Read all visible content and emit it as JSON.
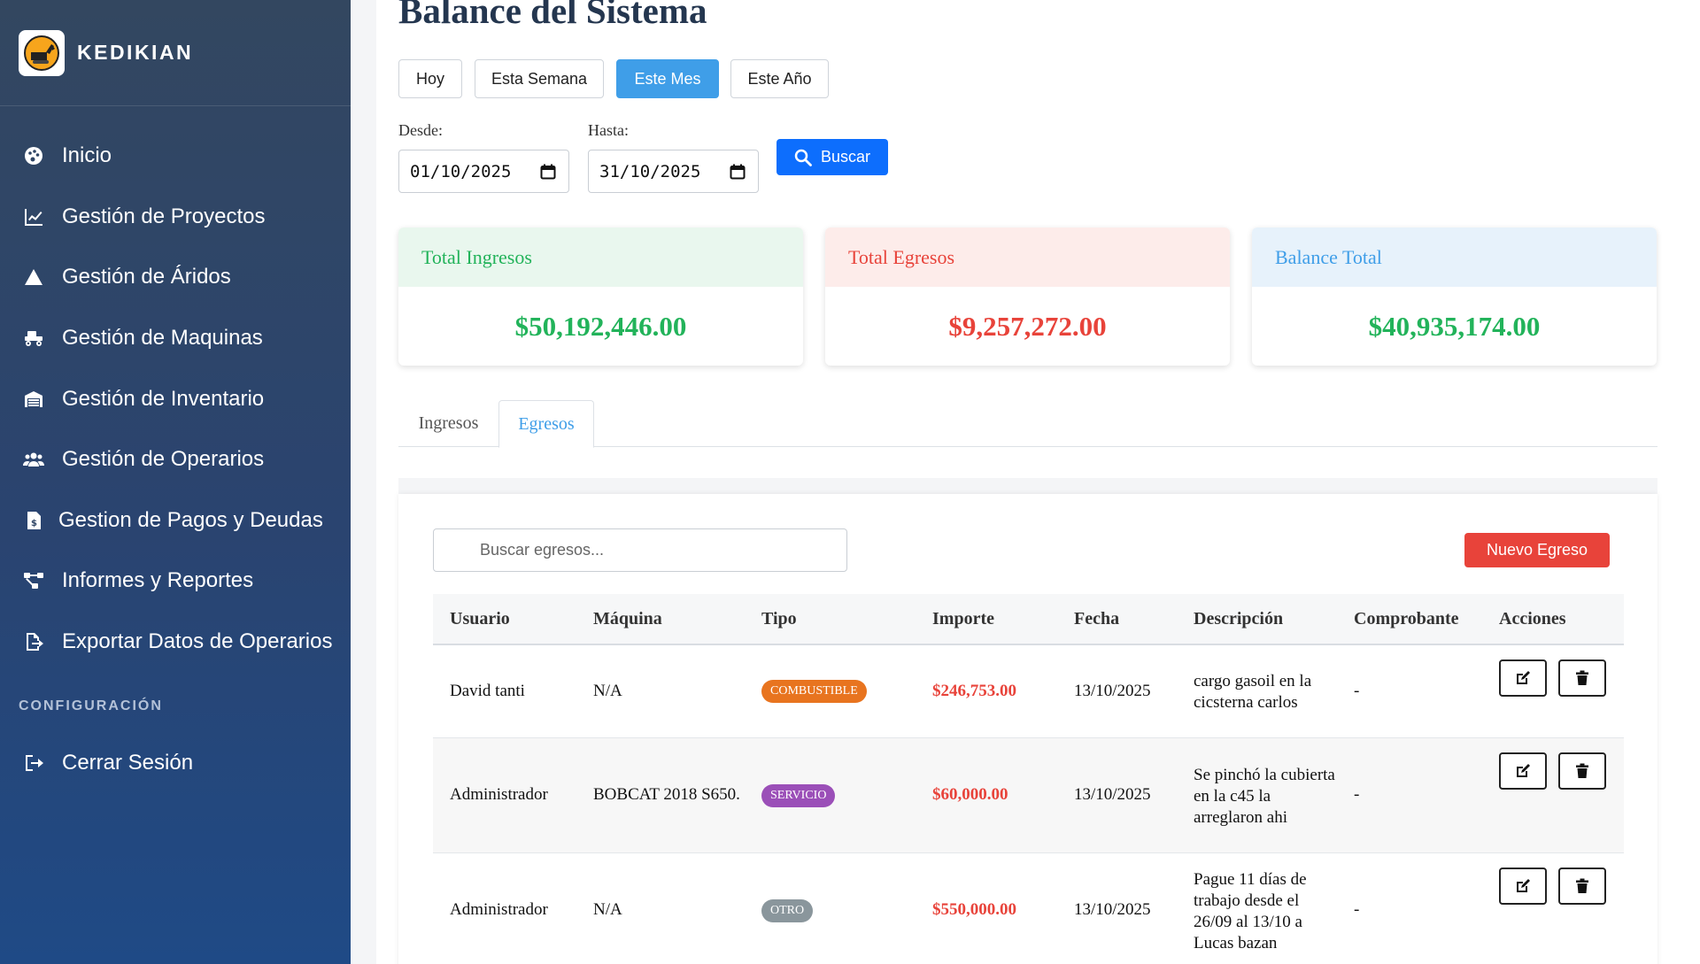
{
  "brand": {
    "name": "KEDIKIAN"
  },
  "sidebar": {
    "items": [
      {
        "label": "Inicio",
        "icon": "palette-icon"
      },
      {
        "label": "Gestión de Proyectos",
        "icon": "chart-line-icon"
      },
      {
        "label": "Gestión de Áridos",
        "icon": "mountain-icon"
      },
      {
        "label": "Gestión de Maquinas",
        "icon": "truck-icon"
      },
      {
        "label": "Gestión de Inventario",
        "icon": "warehouse-icon"
      },
      {
        "label": "Gestión de Operarios",
        "icon": "users-icon"
      },
      {
        "label": "Gestion de Pagos y Deudas",
        "icon": "invoice-dollar-icon"
      },
      {
        "label": "Informes y Reportes",
        "icon": "project-diagram-icon"
      },
      {
        "label": "Exportar Datos de Operarios",
        "icon": "file-export-icon"
      }
    ],
    "section_title": "CONFIGURACIÓN",
    "logout_label": "Cerrar Sesión"
  },
  "page": {
    "title": "Balance del Sistema"
  },
  "periods": {
    "hoy": "Hoy",
    "semana": "Esta Semana",
    "mes": "Este Mes",
    "anio": "Este Año",
    "active": "Este Mes"
  },
  "filters": {
    "desde_label": "Desde:",
    "desde_value": "01/10/2025",
    "hasta_label": "Hasta:",
    "hasta_value": "31/10/2025",
    "search_label": "Buscar"
  },
  "cards": {
    "ingresos": {
      "title": "Total Ingresos",
      "value": "$50,192,446.00"
    },
    "egresos": {
      "title": "Total Egresos",
      "value": "$9,257,272.00"
    },
    "balance": {
      "title": "Balance Total",
      "value": "$40,935,174.00"
    }
  },
  "colors": {
    "income_green": "#22b35a",
    "expense_red": "#e8433a",
    "balance_blue": "#3f9ee8",
    "income_bg": "#e9f7ee",
    "expense_bg": "#fdecea",
    "balance_bg": "#e7f2fb"
  },
  "tabs": {
    "ingresos": "Ingresos",
    "egresos": "Egresos",
    "active": "Egresos"
  },
  "egresos": {
    "search_placeholder": "Buscar egresos...",
    "new_label": "Nuevo Egreso",
    "columns": [
      "Usuario",
      "Máquina",
      "Tipo",
      "Importe",
      "Fecha",
      "Descripción",
      "Comprobante",
      "Acciones"
    ],
    "rows": [
      {
        "usuario": "David tanti",
        "maquina": "N/A",
        "tipo": "COMBUSTIBLE",
        "tipo_color": "#e8741f",
        "importe": "$246,753.00",
        "fecha": "13/10/2025",
        "descripcion": "cargo gasoil en la cicsterna carlos",
        "comprobante": "-"
      },
      {
        "usuario": "Administrador",
        "maquina": "BOBCAT 2018 S650.",
        "tipo": "SERVICIO",
        "tipo_color": "#9b4fb8",
        "importe": "$60,000.00",
        "fecha": "13/10/2025",
        "descripcion": "Se pinchó la cubierta en la c45 la arreglaron ahi",
        "comprobante": "-"
      },
      {
        "usuario": "Administrador",
        "maquina": "N/A",
        "tipo": "OTRO",
        "tipo_color": "#8a969c",
        "importe": "$550,000.00",
        "fecha": "13/10/2025",
        "descripcion": "Pague 11 días de trabajo desde el 26/09 al 13/10 a Lucas bazan",
        "comprobante": "-"
      }
    ]
  }
}
